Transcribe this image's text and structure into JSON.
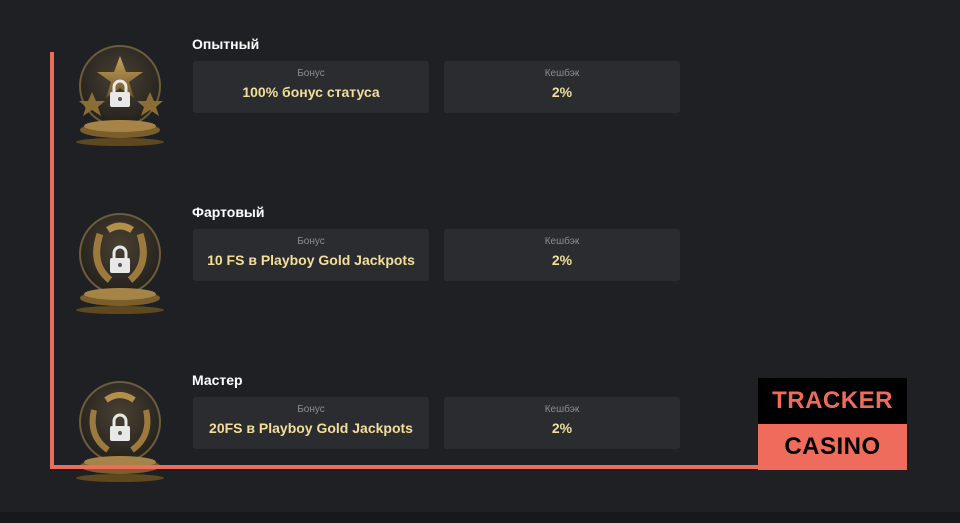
{
  "levels": [
    {
      "title": "Опытный",
      "trophy_icon": "stars-trophy-locked-icon",
      "bonus_label": "Бонус",
      "bonus_value": "100% бонус статуса",
      "cashback_label": "Кешбэк",
      "cashback_value": "2%"
    },
    {
      "title": "Фартовый",
      "trophy_icon": "horseshoe-trophy-locked-icon",
      "bonus_label": "Бонус",
      "bonus_value": "10 FS в Playboy Gold Jackpots",
      "cashback_label": "Кешбэк",
      "cashback_value": "2%"
    },
    {
      "title": "Мастер",
      "trophy_icon": "horseshoe-trophy-locked-icon",
      "bonus_label": "Бонус",
      "bonus_value": "20FS в Playboy Gold Jackpots",
      "cashback_label": "Кешбэк",
      "cashback_value": "2%"
    }
  ],
  "watermark": {
    "top": "TRACKER",
    "bottom": "CASINO"
  },
  "colors": {
    "background": "#1f2024",
    "card": "#2a2c30",
    "value_text": "#f3df9a",
    "accent_line": "#ef6c5c"
  }
}
